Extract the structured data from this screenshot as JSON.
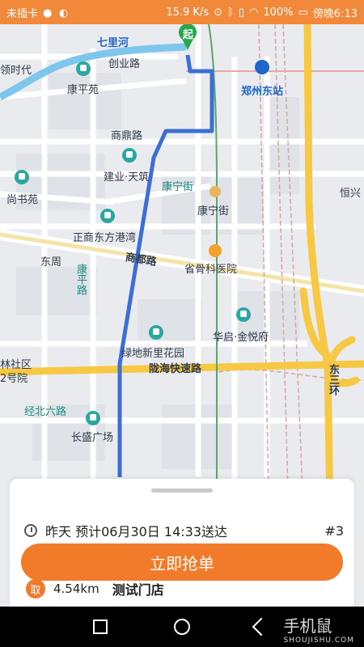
{
  "status_bar": {
    "carrier": "未插卡",
    "speed": "15.9 K/s",
    "battery": "100%",
    "time": "傍晚6:13"
  },
  "map": {
    "labels": {
      "qilihe": "七里河",
      "chuangye_rd": "创业路",
      "kangpingyuan": "康平苑",
      "zhengzhou_east": "郑州东站",
      "shangding_rd": "商鼎路",
      "jianye_tianzhu": "建业·天筑",
      "kangning_st1": "康宁街",
      "kangning_st2": "康宁街",
      "shangshuyuan": "尚书苑",
      "zhengshang": "正商东方港湾",
      "dongzhou": "东周",
      "shangdu_rd": "商都路",
      "provincial_hosp": "省骨科医院",
      "kangping_rd": "康平路",
      "huaqi": "华启·金悦府",
      "lvdi": "绿地新里花园",
      "longhai": "陇海快速路",
      "jingbei6": "经北六路",
      "changsheng": "长盛广场",
      "east3ring": "东三环",
      "hengxing": "恒兴",
      "shidai": "领时代",
      "linshequ": "林社区",
      "yuan2": "2号院",
      "start": "起"
    }
  },
  "order": {
    "time_info": "昨天 预计06月30日 14:33送达",
    "order_no": "#3",
    "grab_button": "立即抢单",
    "pickup_badge": "取",
    "distance": "4.54km",
    "store_name": "测试门店"
  },
  "watermark": {
    "main": "手机鼠",
    "sub": "SHOUJISHU.COM"
  },
  "colors": {
    "accent": "#f27b2b",
    "route": "#3b6fd6",
    "highway": "#f7c844"
  }
}
